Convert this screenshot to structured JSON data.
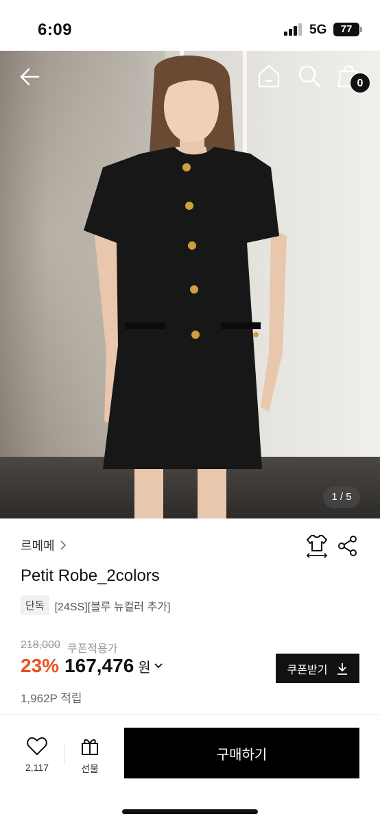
{
  "status_bar": {
    "time": "6:09",
    "network": "5G",
    "battery": "77"
  },
  "header": {
    "back_icon": "arrow-left-icon",
    "home_icon": "home-icon",
    "search_icon": "search-icon",
    "cart_icon": "shopping-bag-icon",
    "cart_count": "0"
  },
  "gallery": {
    "page_indicator": "1 / 5"
  },
  "product": {
    "brand": "르메메",
    "title": "Petit Robe_2colors",
    "exclusive_tag": "단독",
    "subtitle": "[24SS][블루 뉴컬러 추가]",
    "original_price": "218,000",
    "coupon_note": "쿠폰적용가",
    "discount": "23%",
    "price": "167,476",
    "currency": "원",
    "points": "1,962P 적립",
    "coupon_button": "쿠폰받기"
  },
  "bottom_bar": {
    "like_count": "2,117",
    "gift_label": "선물",
    "buy_label": "구매하기"
  },
  "colors": {
    "discount": "#e8521e",
    "primary": "#000000"
  }
}
